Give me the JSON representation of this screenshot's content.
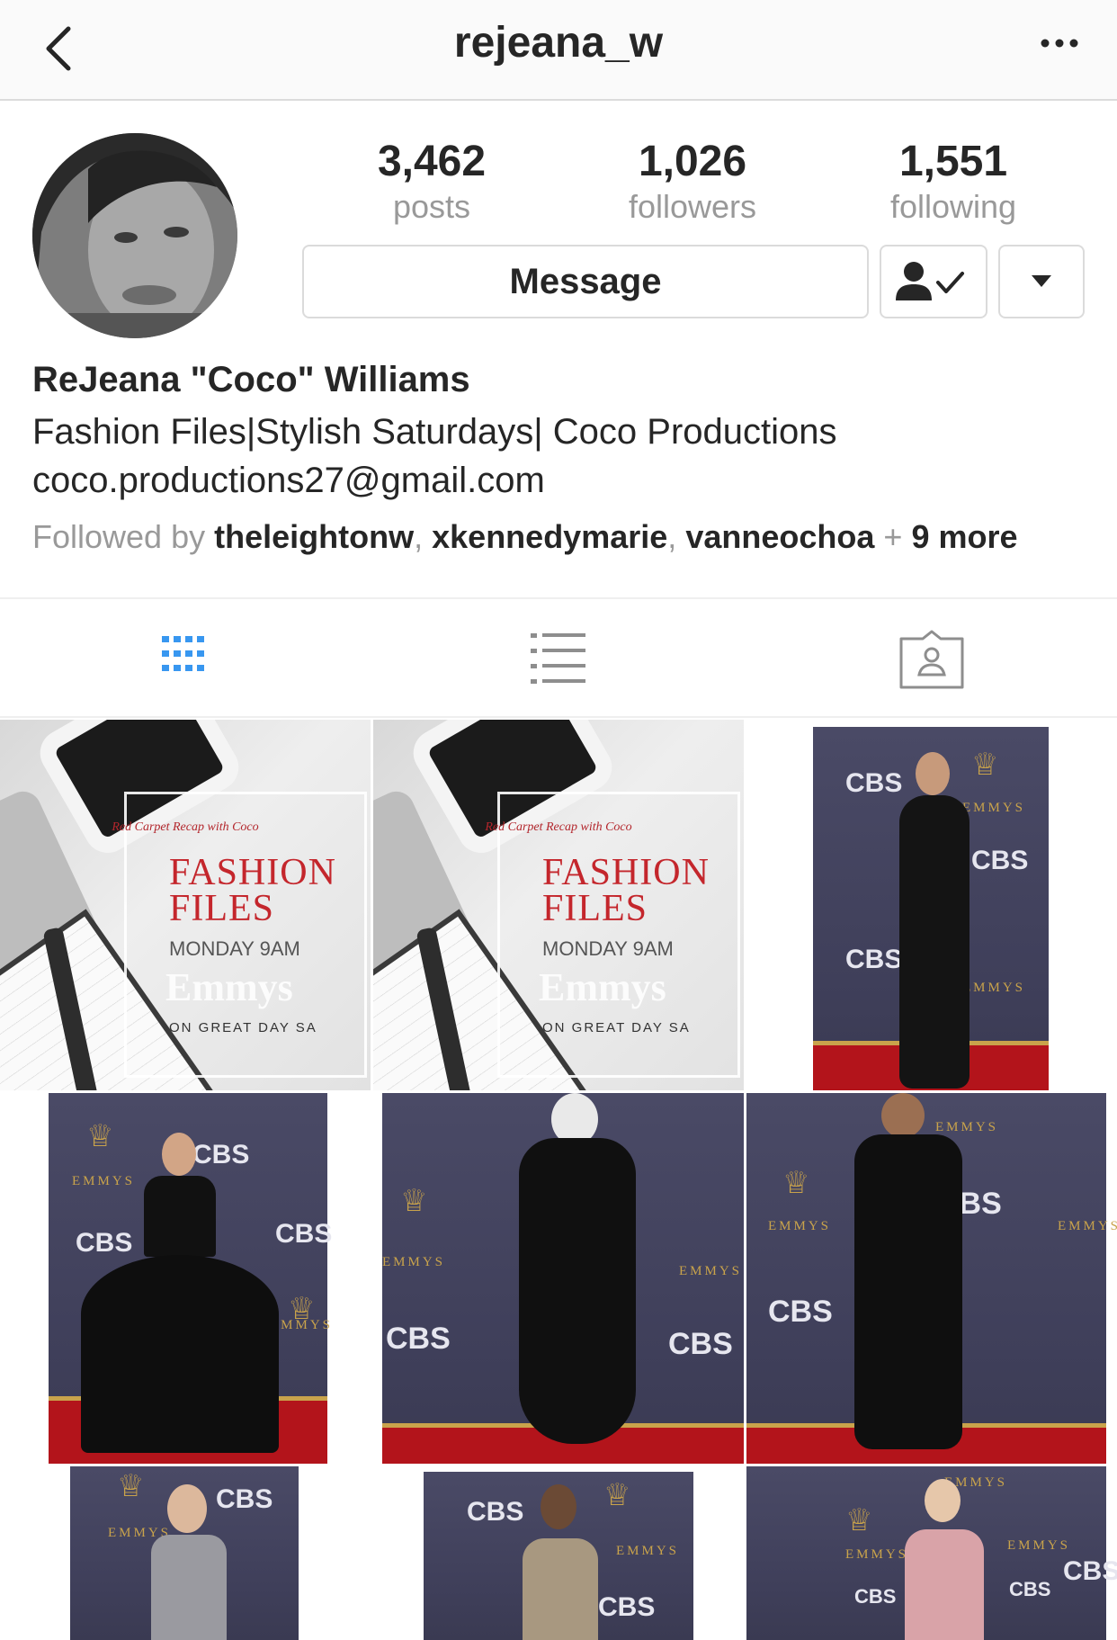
{
  "nav": {
    "title": "rejeana_w",
    "back_icon": "chevron-left-icon",
    "more_icon": "more-horizontal-icon"
  },
  "profile": {
    "stats": [
      {
        "value": "3,462",
        "label": "posts"
      },
      {
        "value": "1,026",
        "label": "followers"
      },
      {
        "value": "1,551",
        "label": "following"
      }
    ],
    "message_label": "Message",
    "full_name": "ReJeana \"Coco\" Williams",
    "bio_line1": "Fashion Files|Stylish Saturdays| Coco Productions",
    "bio_line2": "coco.productions27@gmail.com",
    "followed_by": {
      "prefix": "Followed by",
      "users": [
        "theleightonw",
        "xkennedymarie",
        "vanneochoa"
      ],
      "plus": "+",
      "more": "9 more"
    }
  },
  "tabs": [
    {
      "name": "grid",
      "icon": "grid-icon",
      "active": true
    },
    {
      "name": "list",
      "icon": "list-icon",
      "active": false
    },
    {
      "name": "tagged",
      "icon": "tagged-person-icon",
      "active": false
    }
  ],
  "promo_post": {
    "subtitle": "Red Carpet Recap with Coco",
    "title_line1": "FASHION",
    "title_line2": "FILES",
    "schedule": "MONDAY 9AM",
    "overlay": "Emmys",
    "show": "ON GREAT DAY SA"
  },
  "photo_text": {
    "cbs": "CBS",
    "emmys": "EMMYS"
  },
  "colors": {
    "accent_blue": "#3897f0",
    "text_primary": "#262626",
    "text_secondary": "#999999",
    "border": "#dbdbdb",
    "carpet_red": "#b3141b",
    "backdrop": "#46465f"
  }
}
